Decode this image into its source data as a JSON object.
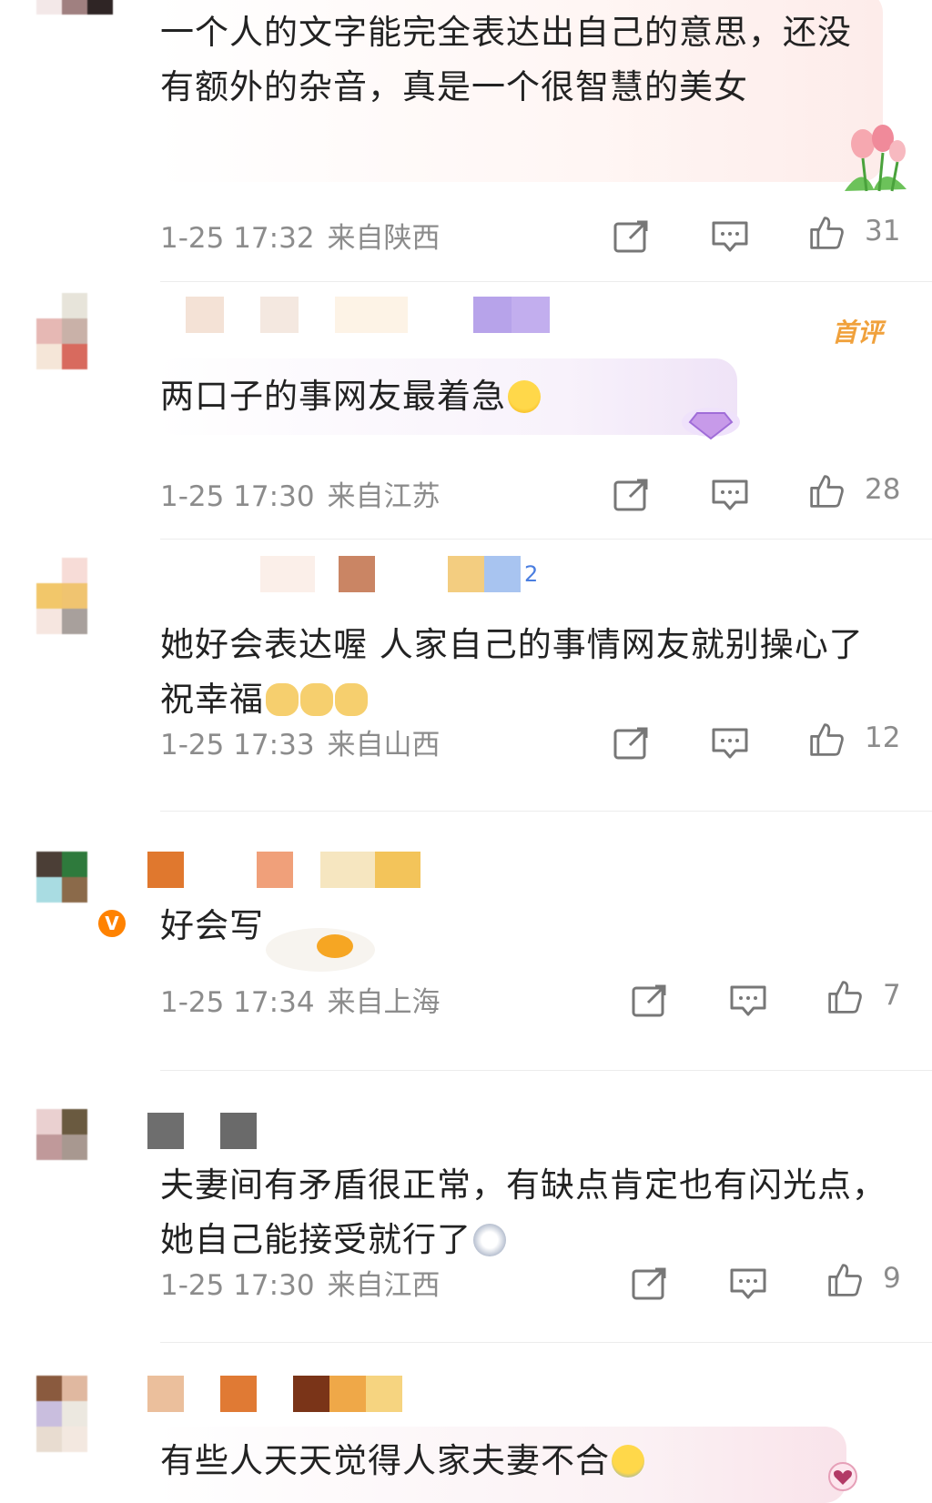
{
  "comments": [
    {
      "text": "一个人的文字能完全表达出自己的意思，还没有额外的杂音，真是一个很智慧的美女",
      "time": "1-25 17:32",
      "region": "来自陕西",
      "likes": "31"
    },
    {
      "text": "两口子的事网友最着急",
      "time": "1-25 17:30",
      "region": "来自江苏",
      "likes": "28",
      "tag": "首评"
    },
    {
      "text": "她好会表达喔 人家自己的事情网友就别操心了 祝幸福",
      "time": "1-25 17:33",
      "region": "来自山西",
      "likes": "12",
      "badge_count": "2"
    },
    {
      "text": "好会写",
      "time": "1-25 17:34",
      "region": "来自上海",
      "likes": "7"
    },
    {
      "text": "夫妻间有矛盾很正常，有缺点肯定也有闪光点，她自己能接受就行了",
      "time": "1-25 17:30",
      "region": "来自江西",
      "likes": "9"
    },
    {
      "text": "有些人天天觉得人家夫妻不合"
    }
  ],
  "icons": {
    "share": "share-icon",
    "comment": "comment-icon",
    "like": "thumbs-up-icon"
  },
  "colors": {
    "meta_text": "#8c8c8c",
    "first_comment_tag": "#f0a13c",
    "verified_badge": "#ff8200"
  }
}
